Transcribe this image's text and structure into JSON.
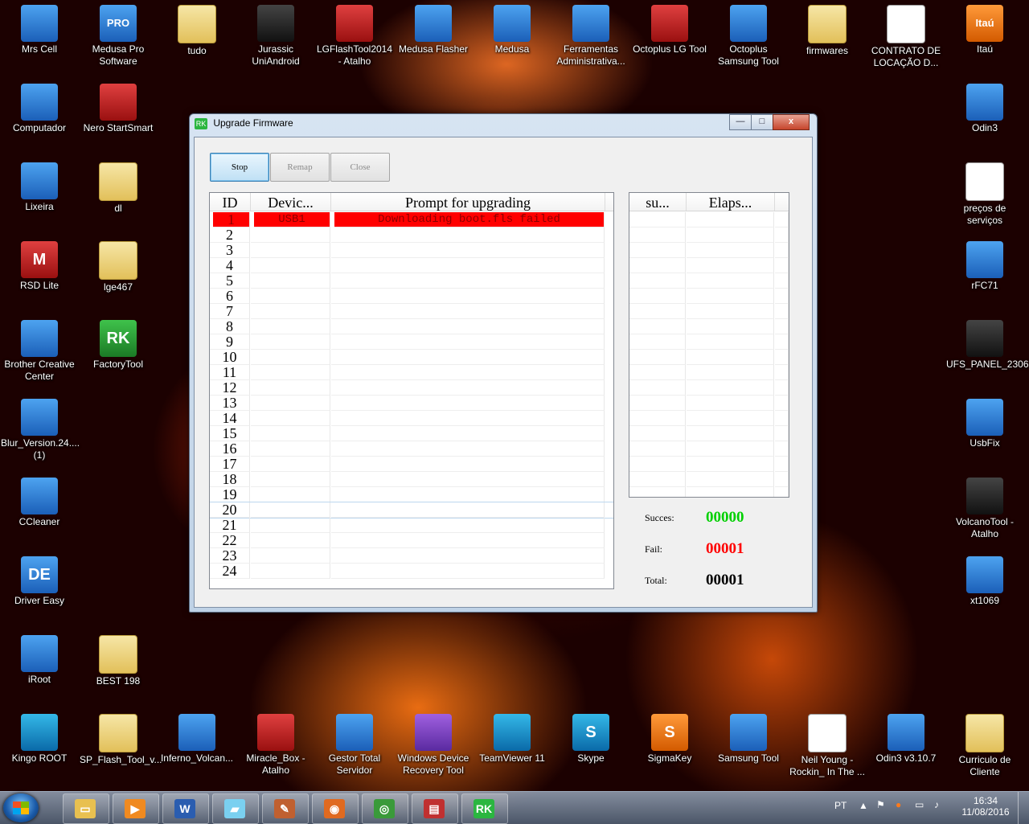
{
  "desktop": {
    "icons_row1": [
      "Mrs Cell",
      "Medusa Pro Software",
      "tudo",
      "Jurassic UniAndroid",
      "LGFlashTool2014 - Atalho",
      "Medusa Flasher",
      "Medusa",
      "Ferramentas Administrativa...",
      "Octoplus LG Tool",
      "Octoplus Samsung Tool",
      "firmwares",
      "CONTRATO DE LOCAÇÃO D...",
      "Itaú"
    ],
    "icons_col1": [
      "Computador",
      "Lixeira",
      "RSD Lite",
      "Brother Creative Center",
      "Blur_Version.24.... (1)",
      "CCleaner",
      "Driver Easy",
      "iRoot"
    ],
    "icons_col2": [
      "Nero StartSmart",
      "dl",
      "lge467",
      "FactoryTool",
      "BEST 198"
    ],
    "icons_right": [
      "Odin3",
      "preços de serviços",
      "rFC71",
      "UFS_PANEL_2306",
      "UsbFix",
      "VolcanoTool - Atalho",
      "xt1069"
    ],
    "icons_bottom": [
      "Kingo ROOT",
      "SP_Flash_Tool_v...",
      "Inferno_Volcan...",
      "Miracle_Box - Atalho",
      "Gestor Total Servidor",
      "Windows Device Recovery Tool",
      "TeamViewer 11",
      "Skype",
      "SigmaKey",
      "Samsung Tool",
      "Neil Young - Rockin_ In The ...",
      "Odin3 v3.10.7",
      "Curriculo de Cliente"
    ],
    "icon_glyphs": {
      "RSD Lite": "M",
      "FactoryTool": "RK",
      "Driver Easy": "DE",
      "SigmaKey": "S",
      "Skype": "S",
      "Itaú": "Itaú",
      "Medusa Pro Software": "PRO"
    }
  },
  "window": {
    "title": "Upgrade Firmware",
    "title_icon": "RK",
    "controls": {
      "minimize": "—",
      "maximize": "□",
      "close": "x"
    },
    "buttons": {
      "stop": "Stop",
      "remap": "Remap",
      "close": "Close"
    },
    "table": {
      "columns": [
        "ID",
        "Devic...",
        "Prompt for upgrading"
      ],
      "rows": [
        {
          "id": "1",
          "device": "USB1",
          "prompt": "Downloading boot.fls failed"
        },
        {
          "id": "2",
          "device": "",
          "prompt": ""
        },
        {
          "id": "3",
          "device": "",
          "prompt": ""
        },
        {
          "id": "4",
          "device": "",
          "prompt": ""
        },
        {
          "id": "5",
          "device": "",
          "prompt": ""
        },
        {
          "id": "6",
          "device": "",
          "prompt": ""
        },
        {
          "id": "7",
          "device": "",
          "prompt": ""
        },
        {
          "id": "8",
          "device": "",
          "prompt": ""
        },
        {
          "id": "9",
          "device": "",
          "prompt": ""
        },
        {
          "id": "10",
          "device": "",
          "prompt": ""
        },
        {
          "id": "11",
          "device": "",
          "prompt": ""
        },
        {
          "id": "12",
          "device": "",
          "prompt": ""
        },
        {
          "id": "13",
          "device": "",
          "prompt": ""
        },
        {
          "id": "14",
          "device": "",
          "prompt": ""
        },
        {
          "id": "15",
          "device": "",
          "prompt": ""
        },
        {
          "id": "16",
          "device": "",
          "prompt": ""
        },
        {
          "id": "17",
          "device": "",
          "prompt": ""
        },
        {
          "id": "18",
          "device": "",
          "prompt": ""
        },
        {
          "id": "19",
          "device": "",
          "prompt": ""
        },
        {
          "id": "20",
          "device": "",
          "prompt": ""
        },
        {
          "id": "21",
          "device": "",
          "prompt": ""
        },
        {
          "id": "22",
          "device": "",
          "prompt": ""
        },
        {
          "id": "23",
          "device": "",
          "prompt": ""
        },
        {
          "id": "24",
          "device": "",
          "prompt": ""
        }
      ]
    },
    "stats_table": {
      "columns": [
        "su...",
        "Elaps..."
      ]
    },
    "stats": {
      "success_label": "Succes:",
      "success_value": "00000",
      "success_color": "#00d000",
      "fail_label": "Fail:",
      "fail_value": "00001",
      "fail_color": "#ff0000",
      "total_label": "Total:",
      "total_value": "00001",
      "total_color": "#000000"
    },
    "error_row_color": "#ff0000"
  },
  "taskbar": {
    "pinned": [
      "explorer-icon",
      "media-player-icon",
      "word-icon",
      "sticky-notes-icon",
      "paint-icon",
      "firefox-icon",
      "chrome-icon",
      "toolbox-icon",
      "rk-factorytool-icon"
    ],
    "language": "PT",
    "time": "16:34",
    "date": "11/08/2016"
  }
}
